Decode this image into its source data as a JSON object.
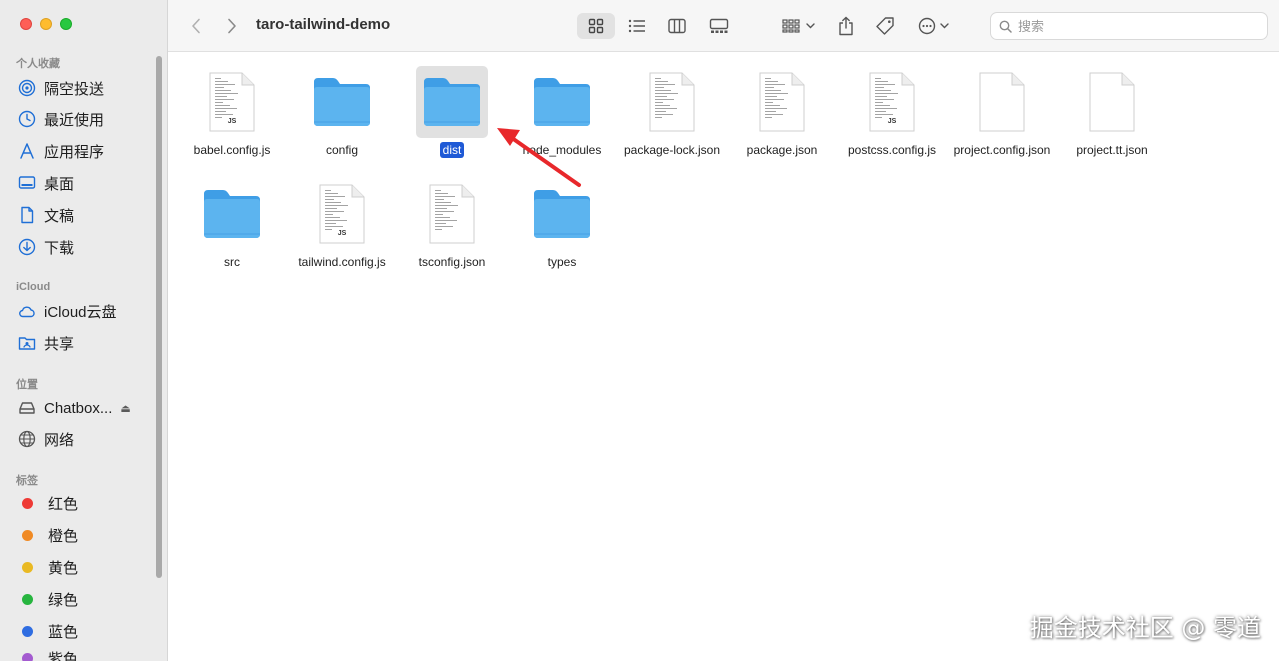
{
  "window": {
    "title": "taro-tailwind-demo"
  },
  "toolbar": {
    "search_placeholder": "搜索"
  },
  "sidebar": {
    "sections": {
      "favorites": "个人收藏",
      "icloud": "iCloud",
      "locations": "位置",
      "tags": "标签"
    },
    "favorites": [
      {
        "label": "隔空投送",
        "icon": "airdrop-icon"
      },
      {
        "label": "最近使用",
        "icon": "clock-icon"
      },
      {
        "label": "应用程序",
        "icon": "applications-icon"
      },
      {
        "label": "桌面",
        "icon": "desktop-icon"
      },
      {
        "label": "文稿",
        "icon": "document-icon"
      },
      {
        "label": "下载",
        "icon": "download-icon"
      }
    ],
    "icloud": [
      {
        "label": "iCloud云盘",
        "icon": "cloud-icon"
      },
      {
        "label": "共享",
        "icon": "shared-folder-icon"
      }
    ],
    "locations": [
      {
        "label": "Chatbox...",
        "icon": "disk-icon"
      },
      {
        "label": "网络",
        "icon": "globe-icon"
      }
    ],
    "tags": [
      {
        "label": "红色",
        "color": "#ee3a35"
      },
      {
        "label": "橙色",
        "color": "#f08a24"
      },
      {
        "label": "黄色",
        "color": "#e9b923"
      },
      {
        "label": "绿色",
        "color": "#27b53f"
      },
      {
        "label": "蓝色",
        "color": "#2f6de1"
      },
      {
        "label": "紫色",
        "color": "#a45bd0"
      }
    ]
  },
  "files": [
    {
      "name": "babel.config.js",
      "type": "js"
    },
    {
      "name": "config",
      "type": "folder"
    },
    {
      "name": "dist",
      "type": "folder",
      "selected": true
    },
    {
      "name": "node_modules",
      "type": "folder"
    },
    {
      "name": "package-lock.json",
      "type": "text"
    },
    {
      "name": "package.json",
      "type": "text"
    },
    {
      "name": "postcss.config.js",
      "type": "js"
    },
    {
      "name": "project.config.json",
      "type": "blank"
    },
    {
      "name": "project.tt.json",
      "type": "blank"
    },
    {
      "name": "src",
      "type": "folder"
    },
    {
      "name": "tailwind.config.js",
      "type": "js"
    },
    {
      "name": "tsconfig.json",
      "type": "text"
    },
    {
      "name": "types",
      "type": "folder"
    }
  ],
  "file_labels": {
    "js_badge": "JS"
  },
  "colors": {
    "folder": "#5cb4ef",
    "selection": "#1f5ad6",
    "annotation_arrow": "#e8282b"
  },
  "watermark": "掘金技术社区 @ 零道"
}
